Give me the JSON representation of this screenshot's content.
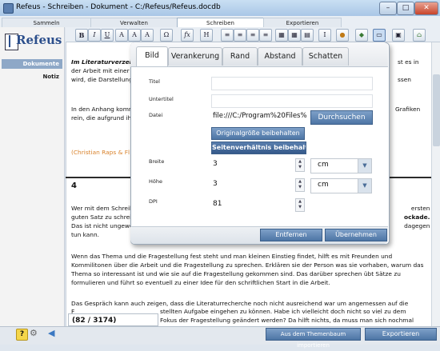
{
  "window": {
    "title": "Refeus - Schreiben - Dokument - C:/Refeus/Refeus.docdb",
    "minimize": "–",
    "maximize": "□",
    "close": "✕"
  },
  "menu_tabs": [
    "Sammeln",
    "Verwalten",
    "Schreiben",
    "Exportieren"
  ],
  "logo_text": "Refeus",
  "sidebar": {
    "items": [
      "Dokumente",
      "Notiz"
    ]
  },
  "toolbar": {
    "buttons": [
      "B",
      "I",
      "U",
      "A",
      "A",
      "A",
      "Ω",
      "fx",
      "H",
      "≡",
      "≡",
      "≡",
      "≡",
      "▦",
      "▦",
      "▤",
      "I",
      "●",
      "◆",
      "▭",
      "▣",
      "⌂"
    ]
  },
  "document": {
    "para1_lines": [
      "Im Literaturverzeich",
      "der Arbeit mit einer L",
      "wird, die Darstellungs"
    ],
    "para1_right": [
      "st es in",
      "ssen"
    ],
    "para2_lines": [
      "In den Anhang komr",
      "rein, die aufgrund ihre"
    ],
    "para2_right": [
      "Grafiken"
    ],
    "citation": "(Christian Raps & Fl",
    "page_number": "4",
    "para3_lines": [
      "Wer mit dem Schreib",
      "guten Satz zu schrei",
      "Das ist nicht ungewö",
      "tun kann."
    ],
    "para3_right": [
      "ersten",
      "ockade.",
      "dagegen"
    ],
    "para4": "Wenn das Thema und die Fragestellung fest steht und man kleinen Einstieg findet, hilft es mit Freunden und Kommilitonen über die Arbeit und die Fragestellung zu sprechen. Erklären sie der Person was sie vorhaben, warum das Thema so interessant ist und wie sie auf die Fragestellung gekommen sind. Das darüber sprechen übt Sätze zu formulieren und führt so eventuell zu einer Idee für den schriftlichen Start in die Arbeit.",
    "para5_line1": "Das Gespräch kann auch zeigen, dass die Literaturrecherche noch nicht ausreichend war um angemessen auf die",
    "para5_line2_left": "F",
    "para5_line2_right": "stellten Aufgabe eingehen zu können. Habe ich vielleicht doch nicht so viel zu dem",
    "para5_line3_right": "Fokus der Fragestellung geändert werden? Da hilft nichts, da muss man sich nochmal"
  },
  "dialog": {
    "tabs": [
      "Bild",
      "Verankerung",
      "Rand",
      "Abstand",
      "Schatten"
    ],
    "active_tab": "Bild",
    "labels": {
      "title": "Titel",
      "subtitle": "Untertitel",
      "file": "Datei",
      "width": "Breite",
      "height": "Höhe",
      "dpi": "DPI"
    },
    "fields": {
      "title": "",
      "subtitle": "",
      "file": "file:///C:/Program%20Files%",
      "width": "3",
      "height": "3",
      "dpi": "81",
      "width_unit": "cm",
      "height_unit": "cm"
    },
    "buttons": {
      "browse": "Durchsuchen",
      "original_size": "Originalgröße beibehalten",
      "keep_ratio": "Seitenverhältnis beibehalten",
      "remove": "Entfernen",
      "apply": "Übernehmen"
    }
  },
  "status": {
    "counter": "(82 / 3174)",
    "import_button": "Aus dem Themenbaum importieren",
    "export_button": "Exportieren",
    "help_icon": "?",
    "settings_icon": "⚙",
    "back_icon": "◀"
  },
  "colors": {
    "accent": "#4d75a5",
    "orange_citation": "#d9822b"
  }
}
